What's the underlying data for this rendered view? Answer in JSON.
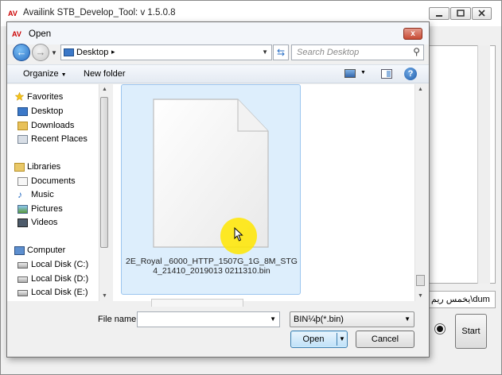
{
  "background_app": {
    "title": "Availink STB_Develop_Tool: v 1.5.0.8",
    "text_field_value": "يخمس ريم\\dum",
    "start_label": "Start"
  },
  "dialog": {
    "title": "Open",
    "close_glyph": "x",
    "address": {
      "location": "Desktop",
      "separator": "▸"
    },
    "search": {
      "placeholder": "Search Desktop"
    },
    "toolbar": {
      "organize": "Organize",
      "new_folder": "New folder",
      "help": "?"
    },
    "nav": {
      "favorites": {
        "label": "Favorites",
        "items": [
          "Desktop",
          "Downloads",
          "Recent Places"
        ]
      },
      "libraries": {
        "label": "Libraries",
        "items": [
          "Documents",
          "Music",
          "Pictures",
          "Videos"
        ]
      },
      "computer": {
        "label": "Computer",
        "items": [
          "Local Disk (C:)",
          "Local Disk (D:)",
          "Local Disk (E:)"
        ]
      }
    },
    "files": [
      {
        "name": "2E_Royal _6000_HTTP_1507G_1G_8M_STG4_21410_2019013 0211310.bin",
        "selected": true
      }
    ],
    "file_name_label": "File name:",
    "file_name_value": "",
    "file_type": "BIN¼þ(*.bin)",
    "open_label": "Open",
    "cancel_label": "Cancel"
  },
  "colors": {
    "selection": "#ddeefc",
    "cursor_highlight": "#ffe600",
    "accent": "#2a6fc4"
  }
}
